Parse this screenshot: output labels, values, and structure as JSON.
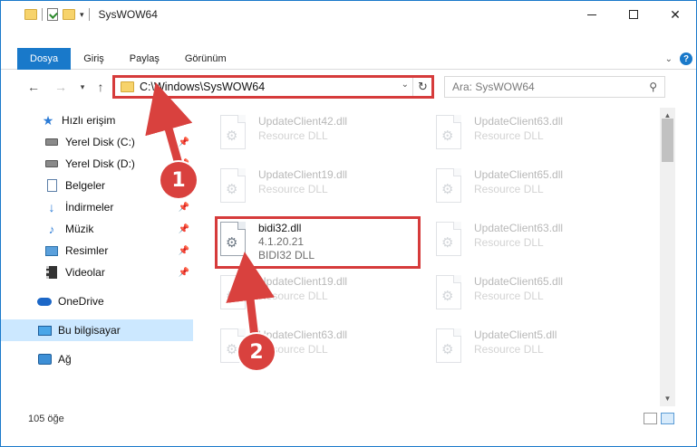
{
  "window": {
    "title": "SysWOW64",
    "controls": {
      "minimize": "—",
      "maximize": "☐",
      "close": "✕"
    }
  },
  "ribbon": {
    "tabs": [
      {
        "label": "Dosya",
        "active": true
      },
      {
        "label": "Giriş"
      },
      {
        "label": "Paylaş"
      },
      {
        "label": "Görünüm"
      }
    ],
    "help": "?"
  },
  "address": {
    "path": "C:\\Windows\\SysWOW64",
    "search_placeholder": "Ara: SysWOW64"
  },
  "sidebar": {
    "items": [
      {
        "label": "Hızlı erişim",
        "icon": "star-icon"
      },
      {
        "label": "Yerel Disk (C:)",
        "icon": "disk-icon",
        "pinned": true
      },
      {
        "label": "Yerel Disk (D:)",
        "icon": "disk-icon",
        "pinned": true
      },
      {
        "label": "Belgeler",
        "icon": "documents-icon",
        "pinned": true
      },
      {
        "label": "İndirmeler",
        "icon": "download-icon",
        "pinned": true
      },
      {
        "label": "Müzik",
        "icon": "music-icon",
        "pinned": true
      },
      {
        "label": "Resimler",
        "icon": "pictures-icon",
        "pinned": true
      },
      {
        "label": "Videolar",
        "icon": "videos-icon",
        "pinned": true
      },
      {
        "label": "OneDrive",
        "icon": "cloud-icon"
      },
      {
        "label": "Bu bilgisayar",
        "icon": "computer-icon",
        "selected": true
      },
      {
        "label": "Ağ",
        "icon": "network-icon"
      }
    ]
  },
  "files": {
    "left": [
      {
        "name": "UpdateClient42.dll",
        "sub": "Resource DLL",
        "faded": true
      },
      {
        "name": "UpdateClient19.dll",
        "sub": "Resource DLL",
        "faded": true
      },
      {
        "name": "bidi32.dll",
        "version": "4.1.20.21",
        "sub": "BIDI32 DLL",
        "faded": false
      },
      {
        "name": "UpdateClient19.dll",
        "sub": "Resource DLL",
        "faded": true
      },
      {
        "name": "UpdateClient63.dll",
        "sub": "Resource DLL",
        "faded": true
      }
    ],
    "right": [
      {
        "name": "UpdateClient63.dll",
        "sub": "Resource DLL",
        "faded": true
      },
      {
        "name": "UpdateClient65.dll",
        "sub": "Resource DLL",
        "faded": true
      },
      {
        "name": "UpdateClient63.dll",
        "sub": "Resource DLL",
        "faded": true
      },
      {
        "name": "UpdateClient65.dll",
        "sub": "Resource DLL",
        "faded": true
      },
      {
        "name": "UpdateClient5.dll",
        "sub": "Resource DLL",
        "faded": true
      }
    ]
  },
  "status": {
    "count": "105 öğe"
  },
  "annotations": {
    "badge1": "1",
    "badge2": "2"
  },
  "colors": {
    "accent": "#1979ca",
    "highlight": "#d63b3b",
    "badge": "#d9413e",
    "selected": "#cce8ff"
  }
}
